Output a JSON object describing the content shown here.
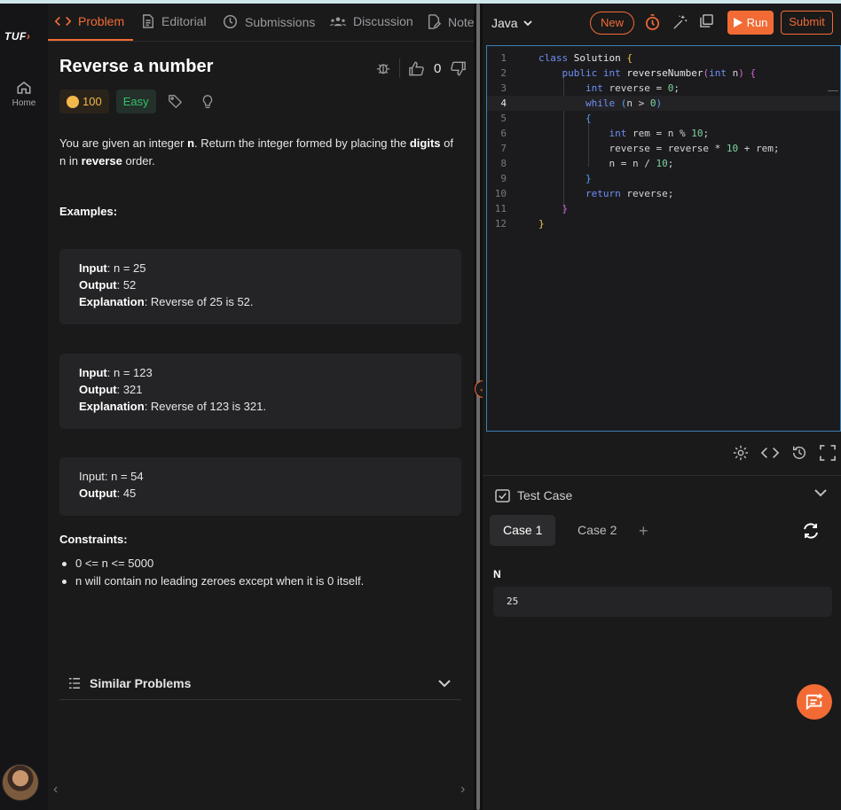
{
  "sidebar": {
    "logo_text": "TUF",
    "home_label": "Home"
  },
  "tabs": [
    {
      "label": "Problem",
      "icon": "code-icon"
    },
    {
      "label": "Editorial",
      "icon": "document-icon"
    },
    {
      "label": "Submissions",
      "icon": "clock-icon"
    },
    {
      "label": "Discussion",
      "icon": "people-icon"
    },
    {
      "label": "Note",
      "icon": "note-icon"
    }
  ],
  "problem": {
    "title": "Reverse a number",
    "likes": "0",
    "coins": "100",
    "difficulty": "Easy",
    "desc_1": "You are given an integer ",
    "desc_n": "n",
    "desc_2": ". Return the integer formed by placing the ",
    "desc_digits": "digits",
    "desc_3": " of n in ",
    "desc_reverse": "reverse",
    "desc_4": " order.",
    "examples_heading": "Examples:",
    "examples": [
      {
        "input_label": "Input",
        "input": ": n = 25",
        "output_label": "Output",
        "output": ": 52",
        "expl_label": "Explanation",
        "expl": ": Reverse of 25 is 52."
      },
      {
        "input_label": "Input",
        "input": ": n = 123",
        "output_label": "Output",
        "output": ": 321",
        "expl_label": "Explanation",
        "expl": ": Reverse of 123 is 321."
      },
      {
        "input_plain": "Input: n = 54",
        "output_label": "Output",
        "output": ": 45"
      }
    ],
    "constraints_heading": "Constraints:",
    "constraints": [
      "0 <= n <= 5000",
      "n will contain no leading zeroes except when it is 0 itself."
    ],
    "similar_label": "Similar Problems"
  },
  "editor": {
    "language": "Java",
    "new_label": "New",
    "run_label": "Run",
    "submit_label": "Submit",
    "line_numbers": [
      "1",
      "2",
      "3",
      "4",
      "5",
      "6",
      "7",
      "8",
      "9",
      "10",
      "11",
      "12"
    ]
  },
  "testcase": {
    "heading": "Test Case",
    "cases": [
      "Case 1",
      "Case 2"
    ],
    "param_name": "N",
    "param_value": "25"
  },
  "colors": {
    "accent": "#f26b35",
    "easy": "#34c06a",
    "coin": "#f2b84b",
    "editor_border": "#3e7fb0"
  }
}
